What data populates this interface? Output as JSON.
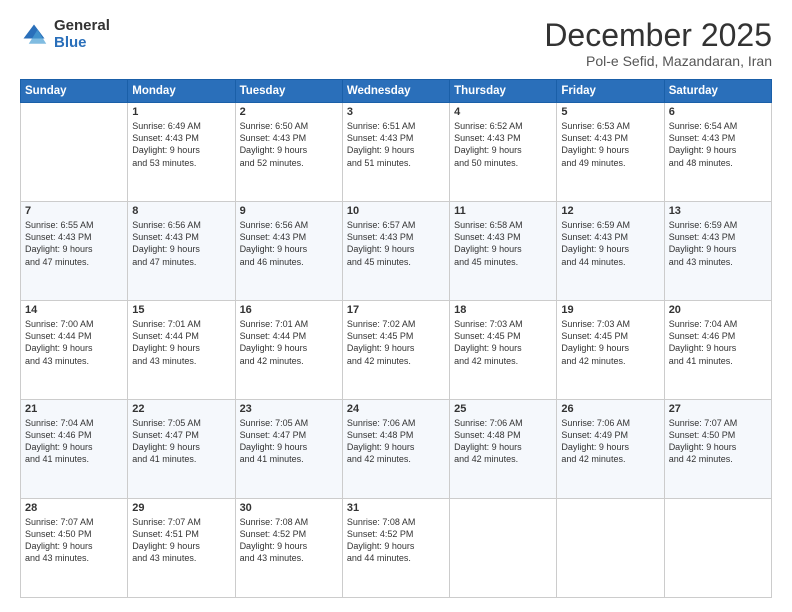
{
  "logo": {
    "general": "General",
    "blue": "Blue"
  },
  "title": {
    "month": "December 2025",
    "location": "Pol-e Sefid, Mazandaran, Iran"
  },
  "weekdays": [
    "Sunday",
    "Monday",
    "Tuesday",
    "Wednesday",
    "Thursday",
    "Friday",
    "Saturday"
  ],
  "weeks": [
    [
      {
        "day": "",
        "info": ""
      },
      {
        "day": "1",
        "info": "Sunrise: 6:49 AM\nSunset: 4:43 PM\nDaylight: 9 hours\nand 53 minutes."
      },
      {
        "day": "2",
        "info": "Sunrise: 6:50 AM\nSunset: 4:43 PM\nDaylight: 9 hours\nand 52 minutes."
      },
      {
        "day": "3",
        "info": "Sunrise: 6:51 AM\nSunset: 4:43 PM\nDaylight: 9 hours\nand 51 minutes."
      },
      {
        "day": "4",
        "info": "Sunrise: 6:52 AM\nSunset: 4:43 PM\nDaylight: 9 hours\nand 50 minutes."
      },
      {
        "day": "5",
        "info": "Sunrise: 6:53 AM\nSunset: 4:43 PM\nDaylight: 9 hours\nand 49 minutes."
      },
      {
        "day": "6",
        "info": "Sunrise: 6:54 AM\nSunset: 4:43 PM\nDaylight: 9 hours\nand 48 minutes."
      }
    ],
    [
      {
        "day": "7",
        "info": "Sunrise: 6:55 AM\nSunset: 4:43 PM\nDaylight: 9 hours\nand 47 minutes."
      },
      {
        "day": "8",
        "info": "Sunrise: 6:56 AM\nSunset: 4:43 PM\nDaylight: 9 hours\nand 47 minutes."
      },
      {
        "day": "9",
        "info": "Sunrise: 6:56 AM\nSunset: 4:43 PM\nDaylight: 9 hours\nand 46 minutes."
      },
      {
        "day": "10",
        "info": "Sunrise: 6:57 AM\nSunset: 4:43 PM\nDaylight: 9 hours\nand 45 minutes."
      },
      {
        "day": "11",
        "info": "Sunrise: 6:58 AM\nSunset: 4:43 PM\nDaylight: 9 hours\nand 45 minutes."
      },
      {
        "day": "12",
        "info": "Sunrise: 6:59 AM\nSunset: 4:43 PM\nDaylight: 9 hours\nand 44 minutes."
      },
      {
        "day": "13",
        "info": "Sunrise: 6:59 AM\nSunset: 4:43 PM\nDaylight: 9 hours\nand 43 minutes."
      }
    ],
    [
      {
        "day": "14",
        "info": "Sunrise: 7:00 AM\nSunset: 4:44 PM\nDaylight: 9 hours\nand 43 minutes."
      },
      {
        "day": "15",
        "info": "Sunrise: 7:01 AM\nSunset: 4:44 PM\nDaylight: 9 hours\nand 43 minutes."
      },
      {
        "day": "16",
        "info": "Sunrise: 7:01 AM\nSunset: 4:44 PM\nDaylight: 9 hours\nand 42 minutes."
      },
      {
        "day": "17",
        "info": "Sunrise: 7:02 AM\nSunset: 4:45 PM\nDaylight: 9 hours\nand 42 minutes."
      },
      {
        "day": "18",
        "info": "Sunrise: 7:03 AM\nSunset: 4:45 PM\nDaylight: 9 hours\nand 42 minutes."
      },
      {
        "day": "19",
        "info": "Sunrise: 7:03 AM\nSunset: 4:45 PM\nDaylight: 9 hours\nand 42 minutes."
      },
      {
        "day": "20",
        "info": "Sunrise: 7:04 AM\nSunset: 4:46 PM\nDaylight: 9 hours\nand 41 minutes."
      }
    ],
    [
      {
        "day": "21",
        "info": "Sunrise: 7:04 AM\nSunset: 4:46 PM\nDaylight: 9 hours\nand 41 minutes."
      },
      {
        "day": "22",
        "info": "Sunrise: 7:05 AM\nSunset: 4:47 PM\nDaylight: 9 hours\nand 41 minutes."
      },
      {
        "day": "23",
        "info": "Sunrise: 7:05 AM\nSunset: 4:47 PM\nDaylight: 9 hours\nand 41 minutes."
      },
      {
        "day": "24",
        "info": "Sunrise: 7:06 AM\nSunset: 4:48 PM\nDaylight: 9 hours\nand 42 minutes."
      },
      {
        "day": "25",
        "info": "Sunrise: 7:06 AM\nSunset: 4:48 PM\nDaylight: 9 hours\nand 42 minutes."
      },
      {
        "day": "26",
        "info": "Sunrise: 7:06 AM\nSunset: 4:49 PM\nDaylight: 9 hours\nand 42 minutes."
      },
      {
        "day": "27",
        "info": "Sunrise: 7:07 AM\nSunset: 4:50 PM\nDaylight: 9 hours\nand 42 minutes."
      }
    ],
    [
      {
        "day": "28",
        "info": "Sunrise: 7:07 AM\nSunset: 4:50 PM\nDaylight: 9 hours\nand 43 minutes."
      },
      {
        "day": "29",
        "info": "Sunrise: 7:07 AM\nSunset: 4:51 PM\nDaylight: 9 hours\nand 43 minutes."
      },
      {
        "day": "30",
        "info": "Sunrise: 7:08 AM\nSunset: 4:52 PM\nDaylight: 9 hours\nand 43 minutes."
      },
      {
        "day": "31",
        "info": "Sunrise: 7:08 AM\nSunset: 4:52 PM\nDaylight: 9 hours\nand 44 minutes."
      },
      {
        "day": "",
        "info": ""
      },
      {
        "day": "",
        "info": ""
      },
      {
        "day": "",
        "info": ""
      }
    ]
  ]
}
